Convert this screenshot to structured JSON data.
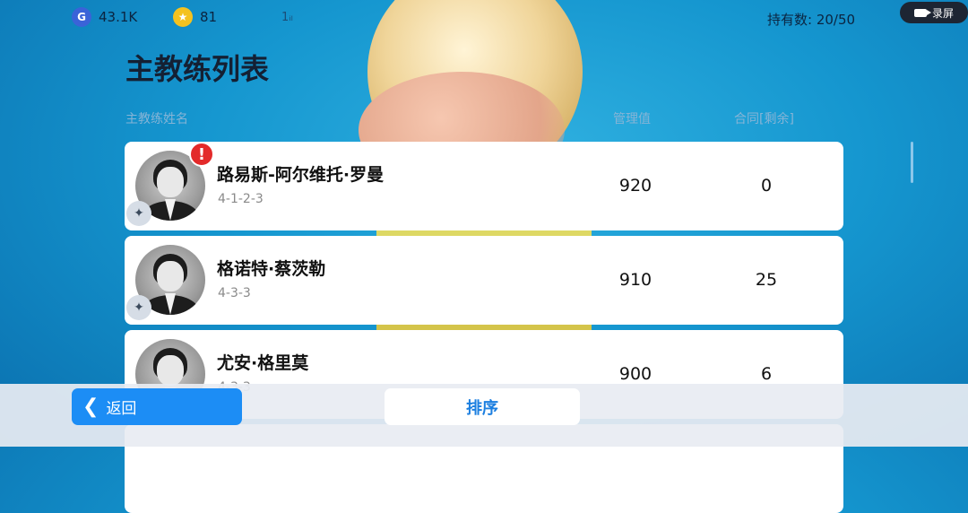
{
  "topbar": {
    "g_currency": "43.1K",
    "g_icon": "G",
    "star_currency": "81",
    "star_icon": "★",
    "signal": "1ᵢₗ",
    "holdings": "持有数: 20/50",
    "record_label": "录屏"
  },
  "page_title": "主教练列表",
  "columns": {
    "name": "主教练姓名",
    "management": "管理值",
    "contract": "合同[剩余]"
  },
  "coaches": [
    {
      "name": "路易斯-阿尔维托·罗曼",
      "formation": "4-1-2-3",
      "management": "920",
      "contract": "0",
      "alert": "!"
    },
    {
      "name": "格诺特·蔡茨勒",
      "formation": "4-3-3",
      "management": "910",
      "contract": "25"
    },
    {
      "name": "尤安·格里莫",
      "formation": "4-3-3",
      "management": "900",
      "contract": "6"
    }
  ],
  "bottom": {
    "back_label": "返回",
    "sort_label": "排序"
  },
  "colors": {
    "accent_blue": "#1c8df5",
    "alert_red": "#e32a2a"
  }
}
